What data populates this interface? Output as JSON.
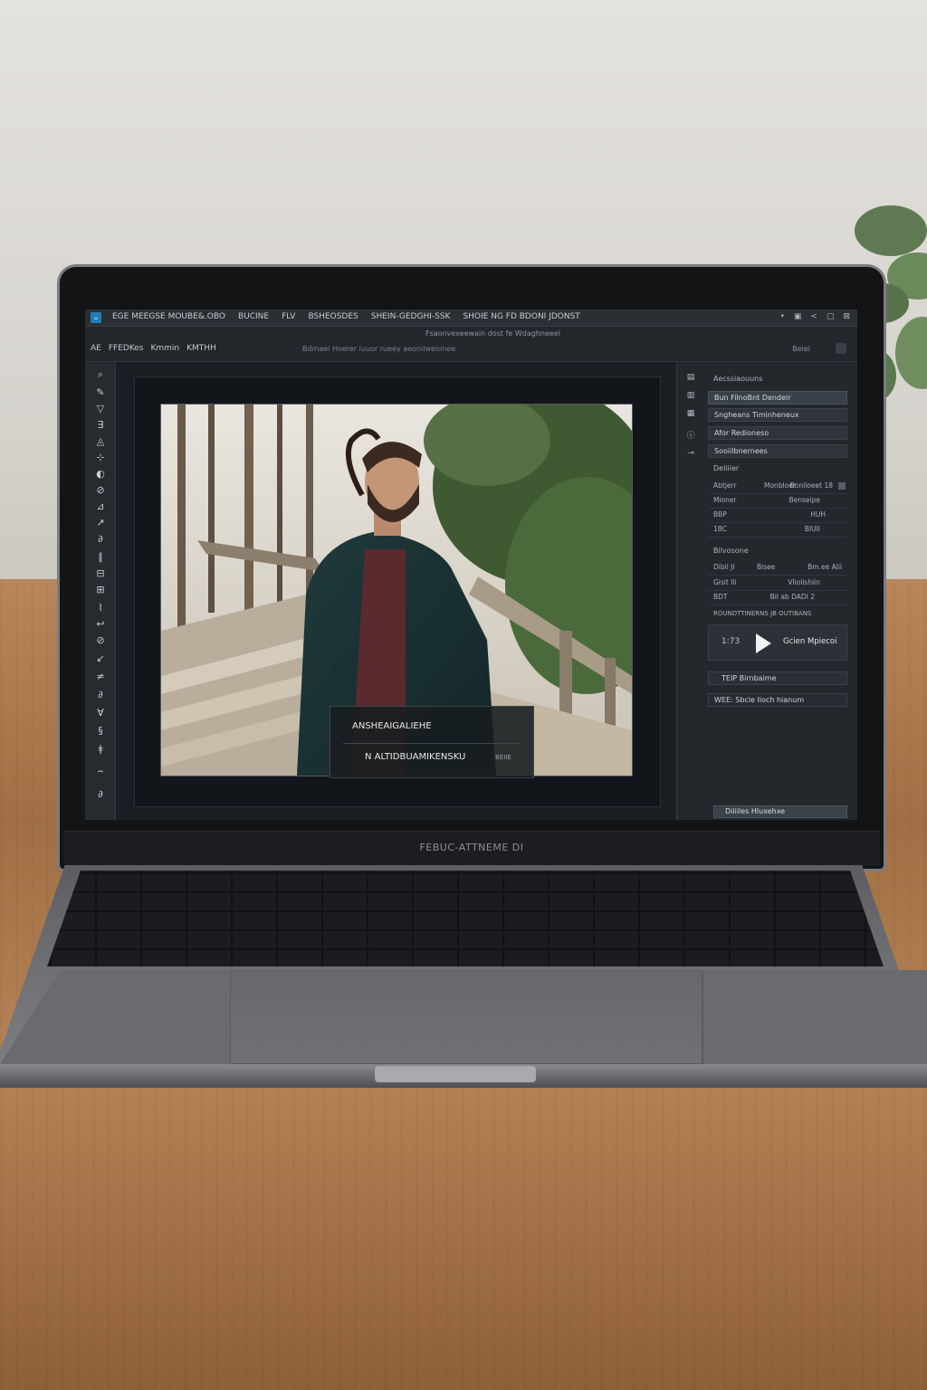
{
  "app": {
    "title_menu": [
      "EGE MEEGSE MOUBE&.OBO",
      "BUCINE",
      "FLV",
      "BSHEOSDES",
      "SHEIN-GEDGHI-SSK",
      "SHOIE NG FD BDONI JDONST"
    ],
    "window_controls": [
      "•",
      "▣",
      "<",
      "▢",
      "⊠"
    ],
    "sub_center_text": "Fsaonvexeewain dost fe Wdaghneeel",
    "options_bar": [
      "AE",
      "FFEDKes",
      "Kmmin",
      "KMTHH"
    ],
    "options_status": "Bdmaei Hoerer iuuor rueey aeonilweninee",
    "options_right": "Beiei"
  },
  "toolbar": {
    "tools": [
      "⌕",
      "✎",
      "▽",
      "∃",
      "◬",
      "⊹",
      "◐",
      "⊘",
      "⊿",
      "↗",
      "∂",
      "∥",
      "⊟",
      "⊞",
      "⌇",
      "↩",
      "⊘",
      "↙",
      "≠",
      "∂",
      "∀",
      "§",
      "ǂ",
      "⌢",
      "∂"
    ]
  },
  "overlay": {
    "line1": "ANSHEAIGALIEHE",
    "line2": "N  ALTIDBUAMIKENSKU",
    "tag": "BEIIE"
  },
  "icon_strip": [
    "▤",
    "▥",
    "▦",
    "ⓘ",
    "⊸"
  ],
  "panel": {
    "heading_top": "Aecssiaouuns",
    "layers": [
      {
        "label": "Bun FilnoBnt Dendeir",
        "active": true
      },
      {
        "label": "Sngheans Timinheneux",
        "active": false
      },
      {
        "label": "Afor Redioneso",
        "active": false
      },
      {
        "label": "Sooiilbnernees",
        "active": false
      }
    ],
    "details_heading": "Deliiier",
    "details": [
      {
        "key": "Abtjerr",
        "mid": "Monbloer",
        "value": "Bonlioeet  18"
      },
      {
        "key": "Mioner",
        "mid": "",
        "value": "Benseipe"
      },
      {
        "key": "BBP",
        "mid": "",
        "value": "HUH"
      },
      {
        "key": "1BC",
        "mid": "",
        "value": "BIUII"
      }
    ],
    "sessions_heading": "Bilvosone",
    "session_rows": [
      {
        "key": "Dibil Ji",
        "mid": "Bisee",
        "value": "Bm.ee   Alii"
      },
      {
        "key": "Gisit Ili",
        "mid": "",
        "value": "Vliolishiin"
      },
      {
        "key": "BDT",
        "mid": "",
        "value": "Bil ab DADI 2"
      }
    ],
    "session_note": "ROUNDTTINERNS  JB OUTIBANS",
    "player": {
      "time": "1:73",
      "label": "Gcien Mpiecoi"
    },
    "extra_row": "TEIP Birnbaime",
    "search_row": "WEE: Sbcle Iioch hianum",
    "bottom_button": "Diiiiles Hluxehxe"
  },
  "laptop": {
    "bezel_label": "FEBUC-ATTNEME DI"
  }
}
